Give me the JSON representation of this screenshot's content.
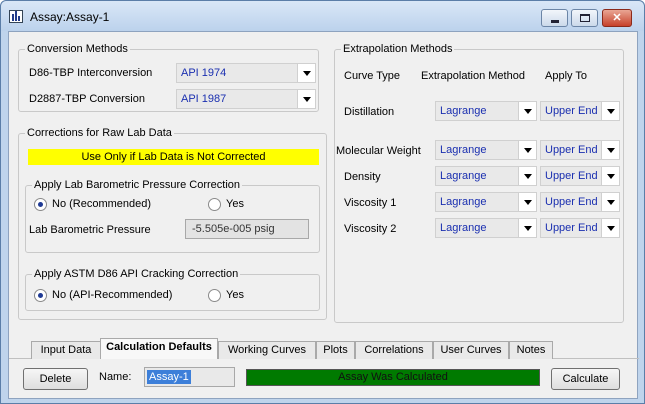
{
  "window": {
    "title": "Assay:Assay-1",
    "controls": {
      "minimize": "minimize",
      "maximize": "maximize",
      "close": "✕"
    }
  },
  "conversion_methods": {
    "group_label": "Conversion Methods",
    "d86_label": "D86-TBP Interconversion",
    "d86_value": "API 1974",
    "d2887_label": "D2887-TBP Conversion",
    "d2887_value": "API 1987"
  },
  "corrections": {
    "group_label": "Corrections for Raw Lab Data",
    "warning": "Use Only if Lab Data is Not Corrected",
    "barometric": {
      "group_label": "Apply Lab Barometric Pressure Correction",
      "option_no": "No (Recommended)",
      "option_yes": "Yes",
      "selected": "No (Recommended)",
      "pressure_label": "Lab Barometric Pressure",
      "pressure_value": "-5.505e-005 psig"
    },
    "cracking": {
      "group_label": "Apply ASTM D86 API Cracking Correction",
      "option_no": "No (API-Recommended)",
      "option_yes": "Yes",
      "selected": "No (API-Recommended)"
    }
  },
  "extrapolation": {
    "group_label": "Extrapolation Methods",
    "headers": {
      "curve_type": "Curve Type",
      "method": "Extrapolation Method",
      "apply_to": "Apply To"
    },
    "rows": [
      {
        "curve": "Distillation",
        "method": "Lagrange",
        "apply_to": "Upper End"
      },
      {
        "curve": "Molecular Weight",
        "method": "Lagrange",
        "apply_to": "Upper End"
      },
      {
        "curve": "Density",
        "method": "Lagrange",
        "apply_to": "Upper End"
      },
      {
        "curve": "Viscosity 1",
        "method": "Lagrange",
        "apply_to": "Upper End"
      },
      {
        "curve": "Viscosity 2",
        "method": "Lagrange",
        "apply_to": "Upper End"
      }
    ]
  },
  "tabs": [
    {
      "label": "Input Data",
      "active": false
    },
    {
      "label": "Calculation Defaults",
      "active": true
    },
    {
      "label": "Working Curves",
      "active": false
    },
    {
      "label": "Plots",
      "active": false
    },
    {
      "label": "Correlations",
      "active": false
    },
    {
      "label": "User Curves",
      "active": false
    },
    {
      "label": "Notes",
      "active": false
    }
  ],
  "footer": {
    "delete_label": "Delete",
    "name_label": "Name:",
    "name_value": "Assay-1",
    "status": "Assay Was Calculated",
    "status_color": "#007a00",
    "calculate_label": "Calculate"
  },
  "colors": {
    "warning_bg": "#ffff00",
    "combo_text": "#1a2fb0",
    "selection": "#3d7fd9"
  }
}
